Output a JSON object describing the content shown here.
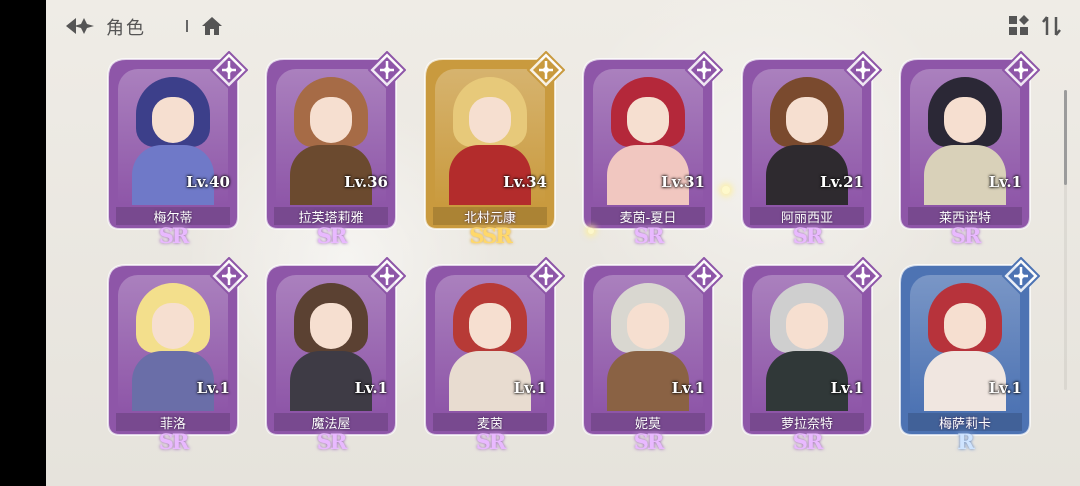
{
  "header": {
    "title": "角色",
    "back_icon": "back-arrow-icon",
    "home_icon": "home-icon",
    "layout_icon": "grid-layout-icon",
    "sort_icon": "sort-icon"
  },
  "colors": {
    "sr_frame": "#8e56a8",
    "ssr_frame": "#c99a3e",
    "r_frame": "#4d73b3",
    "sr_text": "#e9b9ff",
    "ssr_text": "#ffd86a",
    "r_text": "#cfe4ff"
  },
  "characters": [
    {
      "name": "梅尔蒂",
      "level": "Lv.40",
      "rarity": "SR",
      "emblem": "crest-icon",
      "hair": "#3c3f8a",
      "outfit": "#6f79c8"
    },
    {
      "name": "拉芙塔莉雅",
      "level": "Lv.36",
      "rarity": "SR",
      "emblem": "sword-emblem-icon",
      "hair": "#a66b46",
      "outfit": "#6b4a2f"
    },
    {
      "name": "北村元康",
      "level": "Lv.34",
      "rarity": "SSR",
      "emblem": "spear-emblem-icon",
      "hair": "#e7c97a",
      "outfit": "#b32c2c"
    },
    {
      "name": "麦茵-夏日",
      "level": "Lv.31",
      "rarity": "SR",
      "emblem": "spear-emblem-icon",
      "hair": "#b4283a",
      "outfit": "#f1c7c0"
    },
    {
      "name": "阿丽西亚",
      "level": "Lv.21",
      "rarity": "SR",
      "emblem": "spear-emblem-icon",
      "hair": "#7a4a2e",
      "outfit": "#2e2a2f"
    },
    {
      "name": "莱西诺特",
      "level": "Lv.1",
      "rarity": "SR",
      "emblem": "crest-icon",
      "hair": "#2b2836",
      "outfit": "#d9d1b9"
    },
    {
      "name": "菲洛",
      "level": "Lv.1",
      "rarity": "SR",
      "emblem": "spear-emblem-icon",
      "hair": "#f3df8c",
      "outfit": "#6a6ea8"
    },
    {
      "name": "魔法屋",
      "level": "Lv.1",
      "rarity": "SR",
      "emblem": "crest-icon",
      "hair": "#5b4132",
      "outfit": "#3e3b45"
    },
    {
      "name": "麦茵",
      "level": "Lv.1",
      "rarity": "SR",
      "emblem": "spear-emblem-icon",
      "hair": "#b73a36",
      "outfit": "#e8dcd0"
    },
    {
      "name": "妮莫",
      "level": "Lv.1",
      "rarity": "SR",
      "emblem": "crest-icon",
      "hair": "#d9d7d0",
      "outfit": "#8a6244"
    },
    {
      "name": "萝拉奈特",
      "level": "Lv.1",
      "rarity": "SR",
      "emblem": "spear-emblem-icon",
      "hair": "#cfcfcf",
      "outfit": "#303838"
    },
    {
      "name": "梅萨莉卡",
      "level": "Lv.1",
      "rarity": "R",
      "emblem": "crest-icon",
      "hair": "#b7333b",
      "outfit": "#f0e6e0"
    }
  ]
}
